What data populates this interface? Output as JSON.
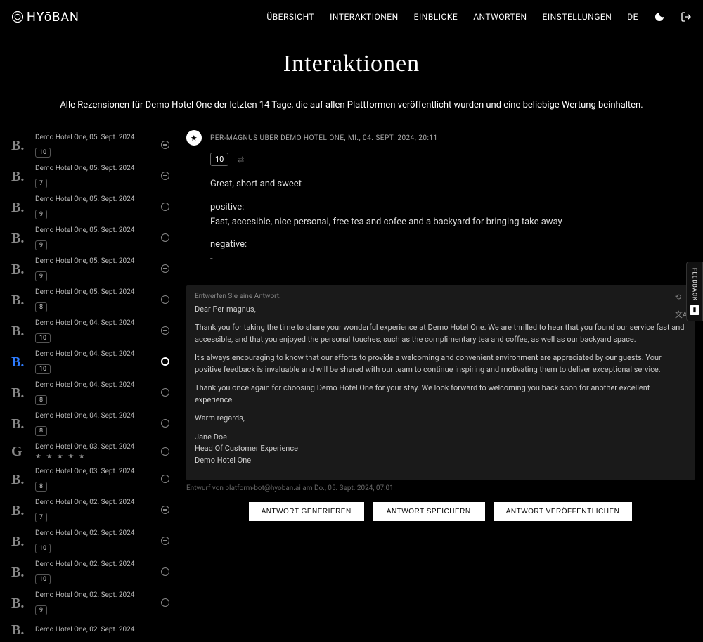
{
  "brand": "HYōBAN",
  "nav": {
    "overview": "ÜBERSICHT",
    "interactions": "INTERAKTIONEN",
    "insights": "EINBLICKE",
    "responses": "ANTWORTEN",
    "settings": "EINSTELLUNGEN",
    "lang": "DE"
  },
  "page_title": "Interaktionen",
  "filter": {
    "all_reviews": "Alle Rezensionen",
    "for": " für ",
    "hotel": "Demo Hotel One",
    "last": " der letzten ",
    "days": "14 Tage",
    "published": ", die auf ",
    "platforms": "allen Plattformen",
    "published2": " veröffentlicht wurden und eine ",
    "rating": "beliebige",
    "rating_suffix": " Wertung beinhalten."
  },
  "reviews": [
    {
      "source": "B.",
      "hotel": "Demo Hotel One",
      "date": "05. Sept. 2024",
      "score": "10",
      "status": "dash",
      "selected": false
    },
    {
      "source": "B.",
      "hotel": "Demo Hotel One",
      "date": "05. Sept. 2024",
      "score": "7",
      "status": "dash",
      "selected": false
    },
    {
      "source": "B.",
      "hotel": "Demo Hotel One",
      "date": "05. Sept. 2024",
      "score": "9",
      "status": "open",
      "selected": false
    },
    {
      "source": "B.",
      "hotel": "Demo Hotel One",
      "date": "05. Sept. 2024",
      "score": "9",
      "status": "open",
      "selected": false
    },
    {
      "source": "B.",
      "hotel": "Demo Hotel One",
      "date": "05. Sept. 2024",
      "score": "9",
      "status": "dash",
      "selected": false
    },
    {
      "source": "B.",
      "hotel": "Demo Hotel One",
      "date": "05. Sept. 2024",
      "score": "8",
      "status": "open",
      "selected": false
    },
    {
      "source": "B.",
      "hotel": "Demo Hotel One",
      "date": "04. Sept. 2024",
      "score": "10",
      "status": "dash",
      "selected": false
    },
    {
      "source": "B.",
      "hotel": "Demo Hotel One",
      "date": "04. Sept. 2024",
      "score": "10",
      "status": "thick",
      "selected": true
    },
    {
      "source": "B.",
      "hotel": "Demo Hotel One",
      "date": "04. Sept. 2024",
      "score": "8",
      "status": "open",
      "selected": false
    },
    {
      "source": "B.",
      "hotel": "Demo Hotel One",
      "date": "04. Sept. 2024",
      "score": "8",
      "status": "open",
      "selected": false
    },
    {
      "source": "G",
      "hotel": "Demo Hotel One",
      "date": "03. Sept. 2024",
      "stars": "★ ★ ★ ★ ★",
      "status": "open",
      "selected": false
    },
    {
      "source": "B.",
      "hotel": "Demo Hotel One",
      "date": "03. Sept. 2024",
      "score": "8",
      "status": "open",
      "selected": false
    },
    {
      "source": "B.",
      "hotel": "Demo Hotel One",
      "date": "02. Sept. 2024",
      "score": "7",
      "status": "dash",
      "selected": false
    },
    {
      "source": "B.",
      "hotel": "Demo Hotel One",
      "date": "02. Sept. 2024",
      "score": "10",
      "status": "dash",
      "selected": false
    },
    {
      "source": "B.",
      "hotel": "Demo Hotel One",
      "date": "02. Sept. 2024",
      "score": "10",
      "status": "open",
      "selected": false
    },
    {
      "source": "B.",
      "hotel": "Demo Hotel One",
      "date": "02. Sept. 2024",
      "score": "9",
      "status": "open",
      "selected": false
    },
    {
      "source": "B.",
      "hotel": "Demo Hotel One",
      "date": "02. Sept. 2024",
      "score": "",
      "status": "",
      "selected": false
    }
  ],
  "detail": {
    "meta": "PER-MAGNUS ÜBER DEMO HOTEL ONE, MI., 04. SEPT. 2024, 20:11",
    "score": "10",
    "title": "Great, short and sweet",
    "positive_label": "positive:",
    "positive_text": "Fast, accesible, nice personal, free tea and cofee and a backyard for bringing take away",
    "negative_label": "negative:",
    "negative_text": "-"
  },
  "reply": {
    "draft_label": "Entwerfen Sie eine Antwort.",
    "greeting": "Dear Per-magnus,",
    "p1": "Thank you for taking the time to share your wonderful experience at Demo Hotel One. We are thrilled to hear that you found our service fast and accessible, and that you enjoyed the personal touches, such as the complimentary tea and coffee, as well as our backyard space.",
    "p2": "It's always encouraging to know that our efforts to provide a welcoming and convenient environment are appreciated by our guests. Your positive feedback is invaluable and will be shared with our team to continue inspiring and motivating them to deliver exceptional service.",
    "p3": "Thank you once again for choosing Demo Hotel One for your stay. We look forward to welcoming you back soon for another excellent experience.",
    "closing": "Warm regards,",
    "sig_name": "Jane Doe",
    "sig_title": "Head Of Customer Experience",
    "sig_hotel": "Demo Hotel One",
    "footer": "Entwurf von platform-bot@hyoban.ai am Do., 05. Sept. 2024, 07:01"
  },
  "buttons": {
    "generate": "ANTWORT GENERIEREN",
    "save": "ANTWORT SPEICHERN",
    "publish": "ANTWORT VERÖFFENTLICHEN"
  },
  "feedback": "FEEDBACK"
}
